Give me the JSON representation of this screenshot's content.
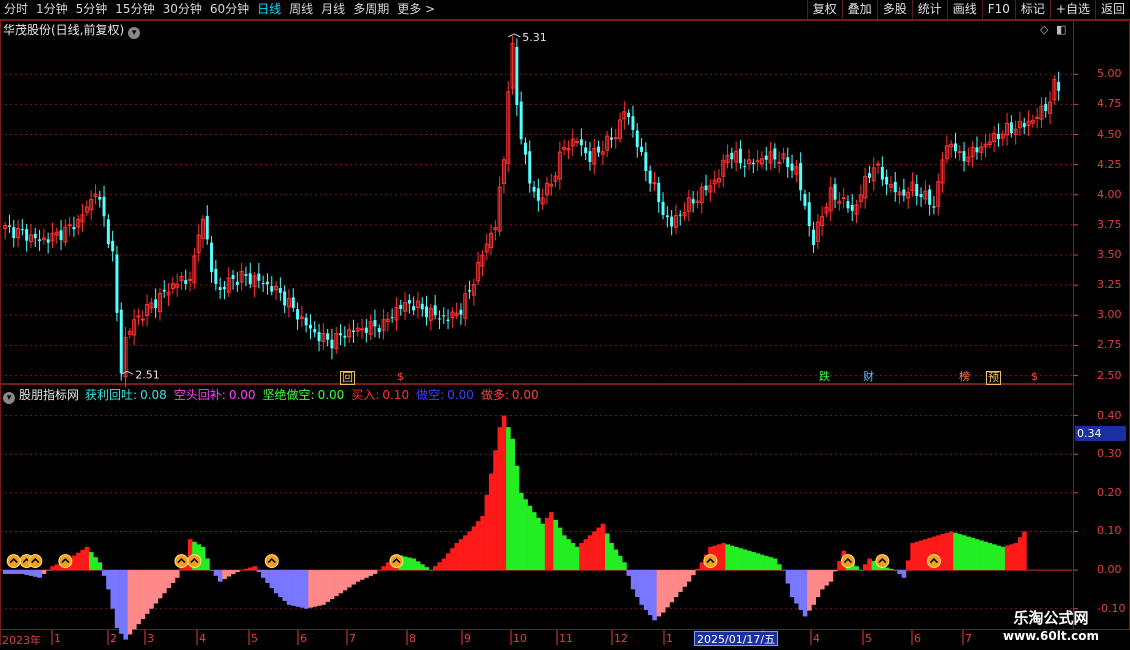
{
  "toolbar": {
    "timeframes": [
      "分时",
      "1分钟",
      "5分钟",
      "15分钟",
      "30分钟",
      "60分钟",
      "日线",
      "周线",
      "月线",
      "多周期",
      "更多 >"
    ],
    "active_timeframe": "日线",
    "actions": [
      "复权",
      "叠加",
      "多股",
      "统计",
      "画线",
      "F10",
      "+自选",
      "返回"
    ],
    "mark_label": "标记"
  },
  "stock": {
    "title": "华茂股份(日线,前复权)"
  },
  "price_axis": [
    "5.00",
    "4.75",
    "4.50",
    "4.25",
    "4.00",
    "3.75",
    "3.50",
    "3.25",
    "3.00",
    "2.75",
    "2.50"
  ],
  "price_range": [
    2.43,
    5.45
  ],
  "high_label": "5.31",
  "low_label": "2.51",
  "event_markers": [
    {
      "text": "回",
      "color": "#f0c060",
      "box": true
    },
    {
      "text": "$",
      "color": "#ff4040",
      "box": false
    },
    {
      "text": "跌",
      "color": "#40ff40",
      "box": false
    },
    {
      "text": "财",
      "color": "#60c0ff",
      "box": false
    },
    {
      "text": "榜",
      "color": "#ff8040",
      "box": false
    },
    {
      "text": "预",
      "color": "#f0c060",
      "box": true
    },
    {
      "text": "$",
      "color": "#ff4040",
      "box": false
    }
  ],
  "indicator": {
    "name": "股朋指标网",
    "items": [
      {
        "label": "获利回吐:",
        "value": "0.08",
        "color": "#40e0e0"
      },
      {
        "label": "空头回补:",
        "value": "0.00",
        "color": "#ff40ff"
      },
      {
        "label": "坚绝做空:",
        "value": "0.00",
        "color": "#40ff40"
      },
      {
        "label": "买入:",
        "value": "0.10",
        "color": "#ff3030"
      },
      {
        "label": "做空:",
        "value": "0.00",
        "color": "#4040ff"
      },
      {
        "label": "做多:",
        "value": "0.00",
        "color": "#ff4040"
      }
    ],
    "axis": [
      "0.40",
      "0.30",
      "0.20",
      "0.10",
      "0.00",
      "-0.10"
    ],
    "range": [
      -0.15,
      0.43
    ],
    "current_value": "0.34"
  },
  "date_axis": {
    "labels": [
      "2023年",
      "1",
      "2",
      "3",
      "4",
      "5",
      "6",
      "7",
      "8",
      "9",
      "10",
      "11",
      "12",
      "1",
      "2",
      "3",
      "4",
      "5",
      "6",
      "7"
    ],
    "cursor_date": "2025/01/17/五"
  },
  "watermark": {
    "line1": "乐淘公式网",
    "line2": "www.60lt.com"
  },
  "colors": {
    "up": "#ff3232",
    "down": "#54ffff",
    "grid": "#7a1a1a",
    "axis": "#e04040",
    "hist_pos": "#ff1a1a",
    "hist_neg": "#7777ff",
    "hist_green": "#22ee22",
    "hist_pink": "#ff8888"
  },
  "chart_data": {
    "type": "candlestick",
    "close_path": [
      [
        0,
        3.72
      ],
      [
        4,
        3.68
      ],
      [
        8,
        3.62
      ],
      [
        11,
        3.65
      ],
      [
        14,
        3.7
      ],
      [
        17,
        3.78
      ],
      [
        20,
        3.95
      ],
      [
        21,
        4.05
      ],
      [
        23,
        3.8
      ],
      [
        25,
        3.5
      ],
      [
        26,
        3.0
      ],
      [
        27,
        2.55
      ],
      [
        28,
        2.8
      ],
      [
        30,
        2.95
      ],
      [
        33,
        3.05
      ],
      [
        36,
        3.15
      ],
      [
        39,
        3.25
      ],
      [
        41,
        3.3
      ],
      [
        42,
        3.25
      ],
      [
        44,
        3.45
      ],
      [
        45,
        3.65
      ],
      [
        46,
        3.85
      ],
      [
        47,
        3.6
      ],
      [
        48,
        3.35
      ],
      [
        50,
        3.2
      ],
      [
        52,
        3.28
      ],
      [
        55,
        3.32
      ],
      [
        58,
        3.3
      ],
      [
        61,
        3.25
      ],
      [
        64,
        3.18
      ],
      [
        67,
        3.05
      ],
      [
        70,
        2.92
      ],
      [
        73,
        2.82
      ],
      [
        76,
        2.78
      ],
      [
        79,
        2.85
      ],
      [
        82,
        2.88
      ],
      [
        85,
        2.9
      ],
      [
        88,
        2.92
      ],
      [
        91,
        3.05
      ],
      [
        94,
        3.1
      ],
      [
        97,
        3.05
      ],
      [
        100,
        3.0
      ],
      [
        103,
        2.97
      ],
      [
        106,
        3.05
      ],
      [
        108,
        3.2
      ],
      [
        110,
        3.4
      ],
      [
        112,
        3.6
      ],
      [
        114,
        3.75
      ],
      [
        116,
        4.3
      ],
      [
        117,
        4.9
      ],
      [
        118,
        5.2
      ],
      [
        119,
        4.75
      ],
      [
        120,
        4.5
      ],
      [
        122,
        4.1
      ],
      [
        124,
        3.95
      ],
      [
        127,
        4.1
      ],
      [
        130,
        4.4
      ],
      [
        133,
        4.45
      ],
      [
        136,
        4.3
      ],
      [
        139,
        4.4
      ],
      [
        142,
        4.5
      ],
      [
        144,
        4.7
      ],
      [
        146,
        4.55
      ],
      [
        148,
        4.3
      ],
      [
        151,
        4.05
      ],
      [
        153,
        3.85
      ],
      [
        155,
        3.75
      ],
      [
        157,
        3.85
      ],
      [
        160,
        3.95
      ],
      [
        163,
        4.05
      ],
      [
        166,
        4.15
      ],
      [
        168,
        4.35
      ],
      [
        170,
        4.3
      ],
      [
        173,
        4.25
      ],
      [
        176,
        4.3
      ],
      [
        179,
        4.32
      ],
      [
        181,
        4.28
      ],
      [
        184,
        4.2
      ],
      [
        186,
        3.9
      ],
      [
        188,
        3.6
      ],
      [
        190,
        3.85
      ],
      [
        192,
        4.0
      ],
      [
        195,
        3.95
      ],
      [
        197,
        3.85
      ],
      [
        200,
        4.1
      ],
      [
        202,
        4.25
      ],
      [
        205,
        4.1
      ],
      [
        208,
        4.0
      ],
      [
        211,
        4.05
      ],
      [
        214,
        3.98
      ],
      [
        216,
        3.9
      ],
      [
        218,
        4.3
      ],
      [
        220,
        4.45
      ],
      [
        222,
        4.3
      ],
      [
        225,
        4.35
      ],
      [
        228,
        4.42
      ],
      [
        231,
        4.5
      ],
      [
        234,
        4.55
      ],
      [
        237,
        4.58
      ],
      [
        240,
        4.65
      ],
      [
        243,
        4.78
      ],
      [
        244,
        4.9
      ]
    ],
    "indicator_path": [
      [
        0,
        -0.01
      ],
      [
        4,
        -0.01
      ],
      [
        8,
        -0.02
      ],
      [
        11,
        0.01
      ],
      [
        15,
        0.03
      ],
      [
        19,
        0.06
      ],
      [
        22,
        0.02
      ],
      [
        24,
        -0.05
      ],
      [
        26,
        -0.15
      ],
      [
        28,
        -0.18
      ],
      [
        31,
        -0.14
      ],
      [
        34,
        -0.1
      ],
      [
        37,
        -0.06
      ],
      [
        40,
        -0.02
      ],
      [
        42,
        0.03
      ],
      [
        43,
        0.08
      ],
      [
        46,
        0.06
      ],
      [
        48,
        0.0
      ],
      [
        50,
        -0.03
      ],
      [
        53,
        -0.01
      ],
      [
        55,
        0.0
      ],
      [
        58,
        0.01
      ],
      [
        60,
        -0.02
      ],
      [
        63,
        -0.06
      ],
      [
        66,
        -0.09
      ],
      [
        70,
        -0.1
      ],
      [
        74,
        -0.09
      ],
      [
        78,
        -0.06
      ],
      [
        82,
        -0.03
      ],
      [
        86,
        -0.01
      ],
      [
        88,
        0.01
      ],
      [
        91,
        0.04
      ],
      [
        95,
        0.03
      ],
      [
        99,
        0.0
      ],
      [
        102,
        0.03
      ],
      [
        105,
        0.07
      ],
      [
        108,
        0.1
      ],
      [
        111,
        0.14
      ],
      [
        113,
        0.25
      ],
      [
        115,
        0.37
      ],
      [
        116,
        0.4
      ],
      [
        118,
        0.34
      ],
      [
        120,
        0.2
      ],
      [
        123,
        0.15
      ],
      [
        125,
        0.12
      ],
      [
        127,
        0.15
      ],
      [
        130,
        0.09
      ],
      [
        133,
        0.06
      ],
      [
        135,
        0.08
      ],
      [
        137,
        0.1
      ],
      [
        139,
        0.12
      ],
      [
        141,
        0.07
      ],
      [
        144,
        0.02
      ],
      [
        146,
        -0.05
      ],
      [
        148,
        -0.09
      ],
      [
        151,
        -0.13
      ],
      [
        153,
        -0.11
      ],
      [
        156,
        -0.07
      ],
      [
        159,
        -0.03
      ],
      [
        162,
        0.02
      ],
      [
        164,
        0.06
      ],
      [
        167,
        0.07
      ],
      [
        170,
        0.06
      ],
      [
        173,
        0.05
      ],
      [
        176,
        0.04
      ],
      [
        179,
        0.03
      ],
      [
        181,
        0.0
      ],
      [
        183,
        -0.07
      ],
      [
        186,
        -0.12
      ],
      [
        188,
        -0.09
      ],
      [
        190,
        -0.05
      ],
      [
        192,
        -0.03
      ],
      [
        195,
        0.05
      ],
      [
        197,
        0.02
      ],
      [
        199,
        0.0
      ],
      [
        201,
        0.03
      ],
      [
        204,
        0.01
      ],
      [
        207,
        0.0
      ],
      [
        209,
        -0.02
      ],
      [
        211,
        0.07
      ],
      [
        214,
        0.08
      ],
      [
        217,
        0.09
      ],
      [
        220,
        0.1
      ],
      [
        223,
        0.09
      ],
      [
        226,
        0.08
      ],
      [
        229,
        0.07
      ],
      [
        232,
        0.06
      ],
      [
        235,
        0.07
      ],
      [
        237,
        0.1
      ]
    ],
    "signal_bars": [
      2,
      5,
      7,
      14,
      41,
      44,
      62,
      91,
      164,
      196,
      204,
      216
    ]
  }
}
